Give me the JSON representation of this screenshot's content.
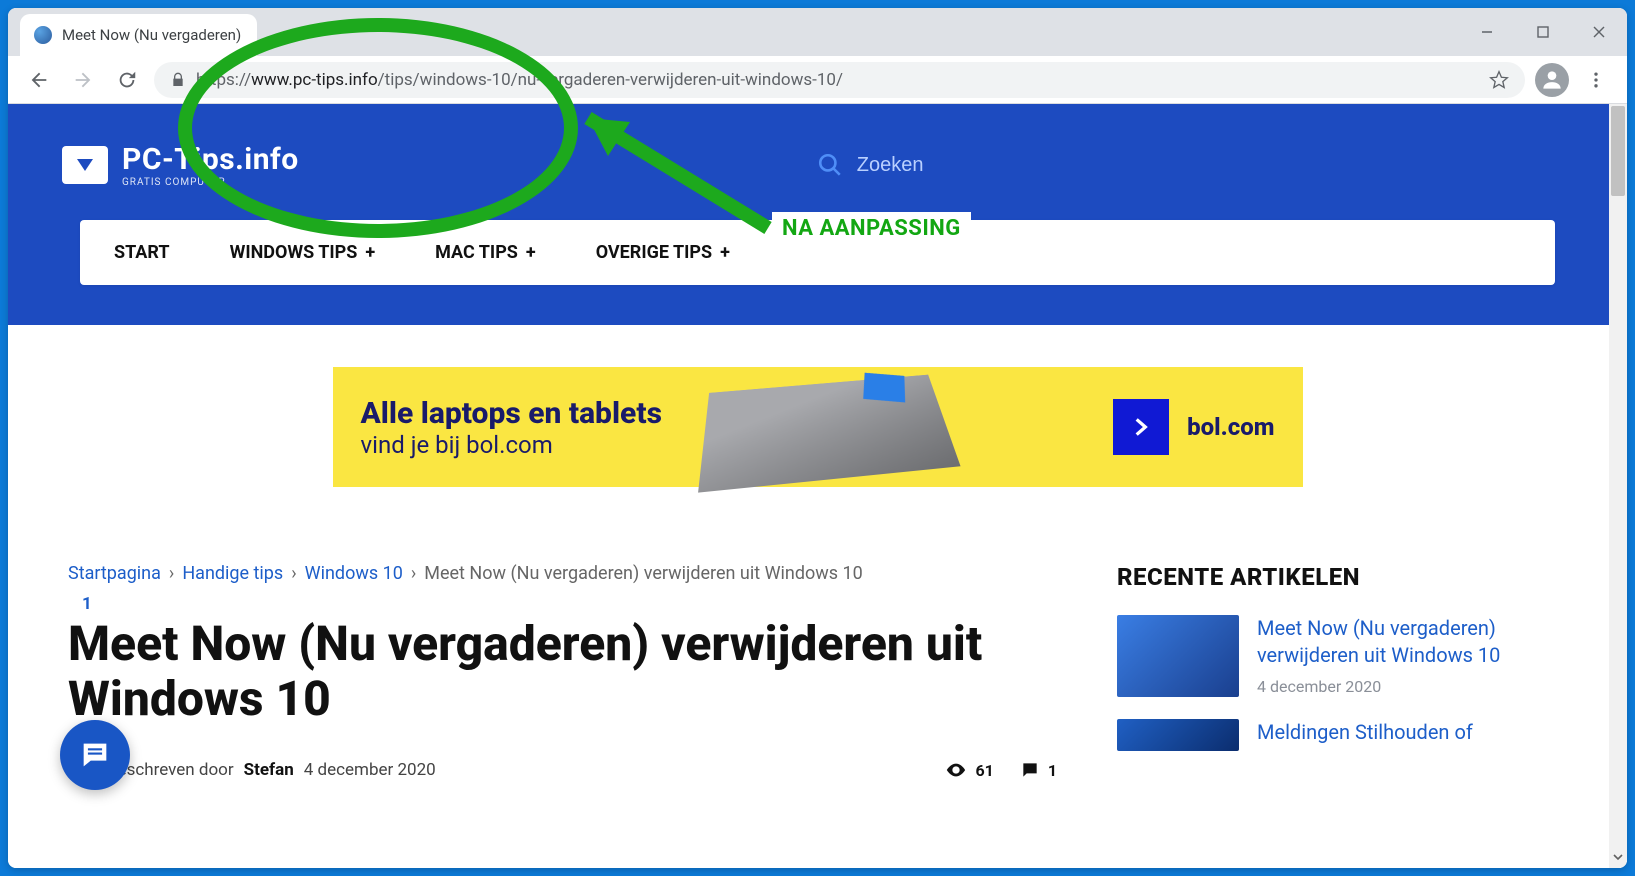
{
  "window": {
    "tab_title": "Meet Now (Nu vergaderen)"
  },
  "address_bar": {
    "scheme": "https://",
    "host": "www.pc-tips.info",
    "path": "/tips/windows-10/nu-vergaderen-verwijderen-uit-windows-10/"
  },
  "site": {
    "logo_title": "PC-Tips.info",
    "logo_sub": "GRATIS COMPUTER",
    "search_placeholder": "Zoeken"
  },
  "nav": {
    "items": [
      {
        "label": "START",
        "has_sub": false
      },
      {
        "label": "WINDOWS TIPS",
        "has_sub": true
      },
      {
        "label": "MAC TIPS",
        "has_sub": true
      },
      {
        "label": "OVERIGE TIPS",
        "has_sub": true
      }
    ]
  },
  "ad": {
    "line1": "Alle laptops en tablets",
    "line2": "vind je bij bol.com",
    "brand": "bol.com"
  },
  "breadcrumb": {
    "items": [
      "Startpagina",
      "Handige tips",
      "Windows 10",
      "Meet Now (Nu vergaderen) verwijderen uit Windows 10"
    ]
  },
  "article": {
    "share_count": "1",
    "title": "Meet Now (Nu vergaderen) verwijderen uit Windows 10",
    "byline_prefix": "Geschreven door",
    "author": "Stefan",
    "date": "4 december 2020",
    "views": "61",
    "comments": "1"
  },
  "sidebar": {
    "heading": "RECENTE ARTIKELEN",
    "items": [
      {
        "title": "Meet Now (Nu vergaderen) verwijderen uit Windows 10",
        "date": "4 december 2020"
      },
      {
        "title": "Meldingen Stilhouden of",
        "date": ""
      }
    ]
  },
  "annotation": {
    "label": "NA AANPASSING"
  }
}
